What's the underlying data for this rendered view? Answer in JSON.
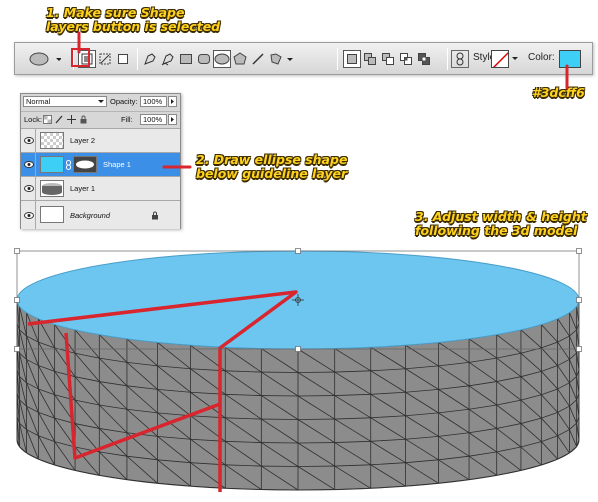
{
  "annotations": {
    "step1_line1": "1. Make sure Shape",
    "step1_line2": "layers button is selected",
    "step2_line1": "2. Draw ellipse shape",
    "step2_line2": "below guideline layer",
    "step3_line1": "3. Adjust width & height",
    "step3_line2": "following the 3d model",
    "color_hex": "#3dcff6"
  },
  "options_bar": {
    "style_label": "Style:",
    "color_label": "Color:",
    "color_value": "#3dcff6"
  },
  "layers_panel": {
    "blend_mode": "Normal",
    "opacity_label": "Opacity:",
    "opacity_value": "100%",
    "lock_label": "Lock:",
    "fill_label": "Fill:",
    "fill_value": "100%",
    "layers": [
      {
        "name": "Layer 2"
      },
      {
        "name": "Shape 1"
      },
      {
        "name": "Layer 1"
      },
      {
        "name": "Background"
      }
    ]
  },
  "colors": {
    "annotation_yellow": "#ffd21f",
    "guide_red": "#d8252e",
    "ellipse_fill": "#6cc6f0",
    "model_gray": "#8a8a8a"
  },
  "icons": [
    "ellipse-tool-icon",
    "shape-layers-icon",
    "paths-icon",
    "fill-pixels-icon",
    "pen-icon",
    "freeform-pen-icon",
    "rectangle-icon",
    "rounded-rect-icon",
    "ellipse-icon",
    "polygon-icon",
    "line-icon",
    "custom-shape-icon",
    "link-icon",
    "eye-icon",
    "lock-icon"
  ]
}
